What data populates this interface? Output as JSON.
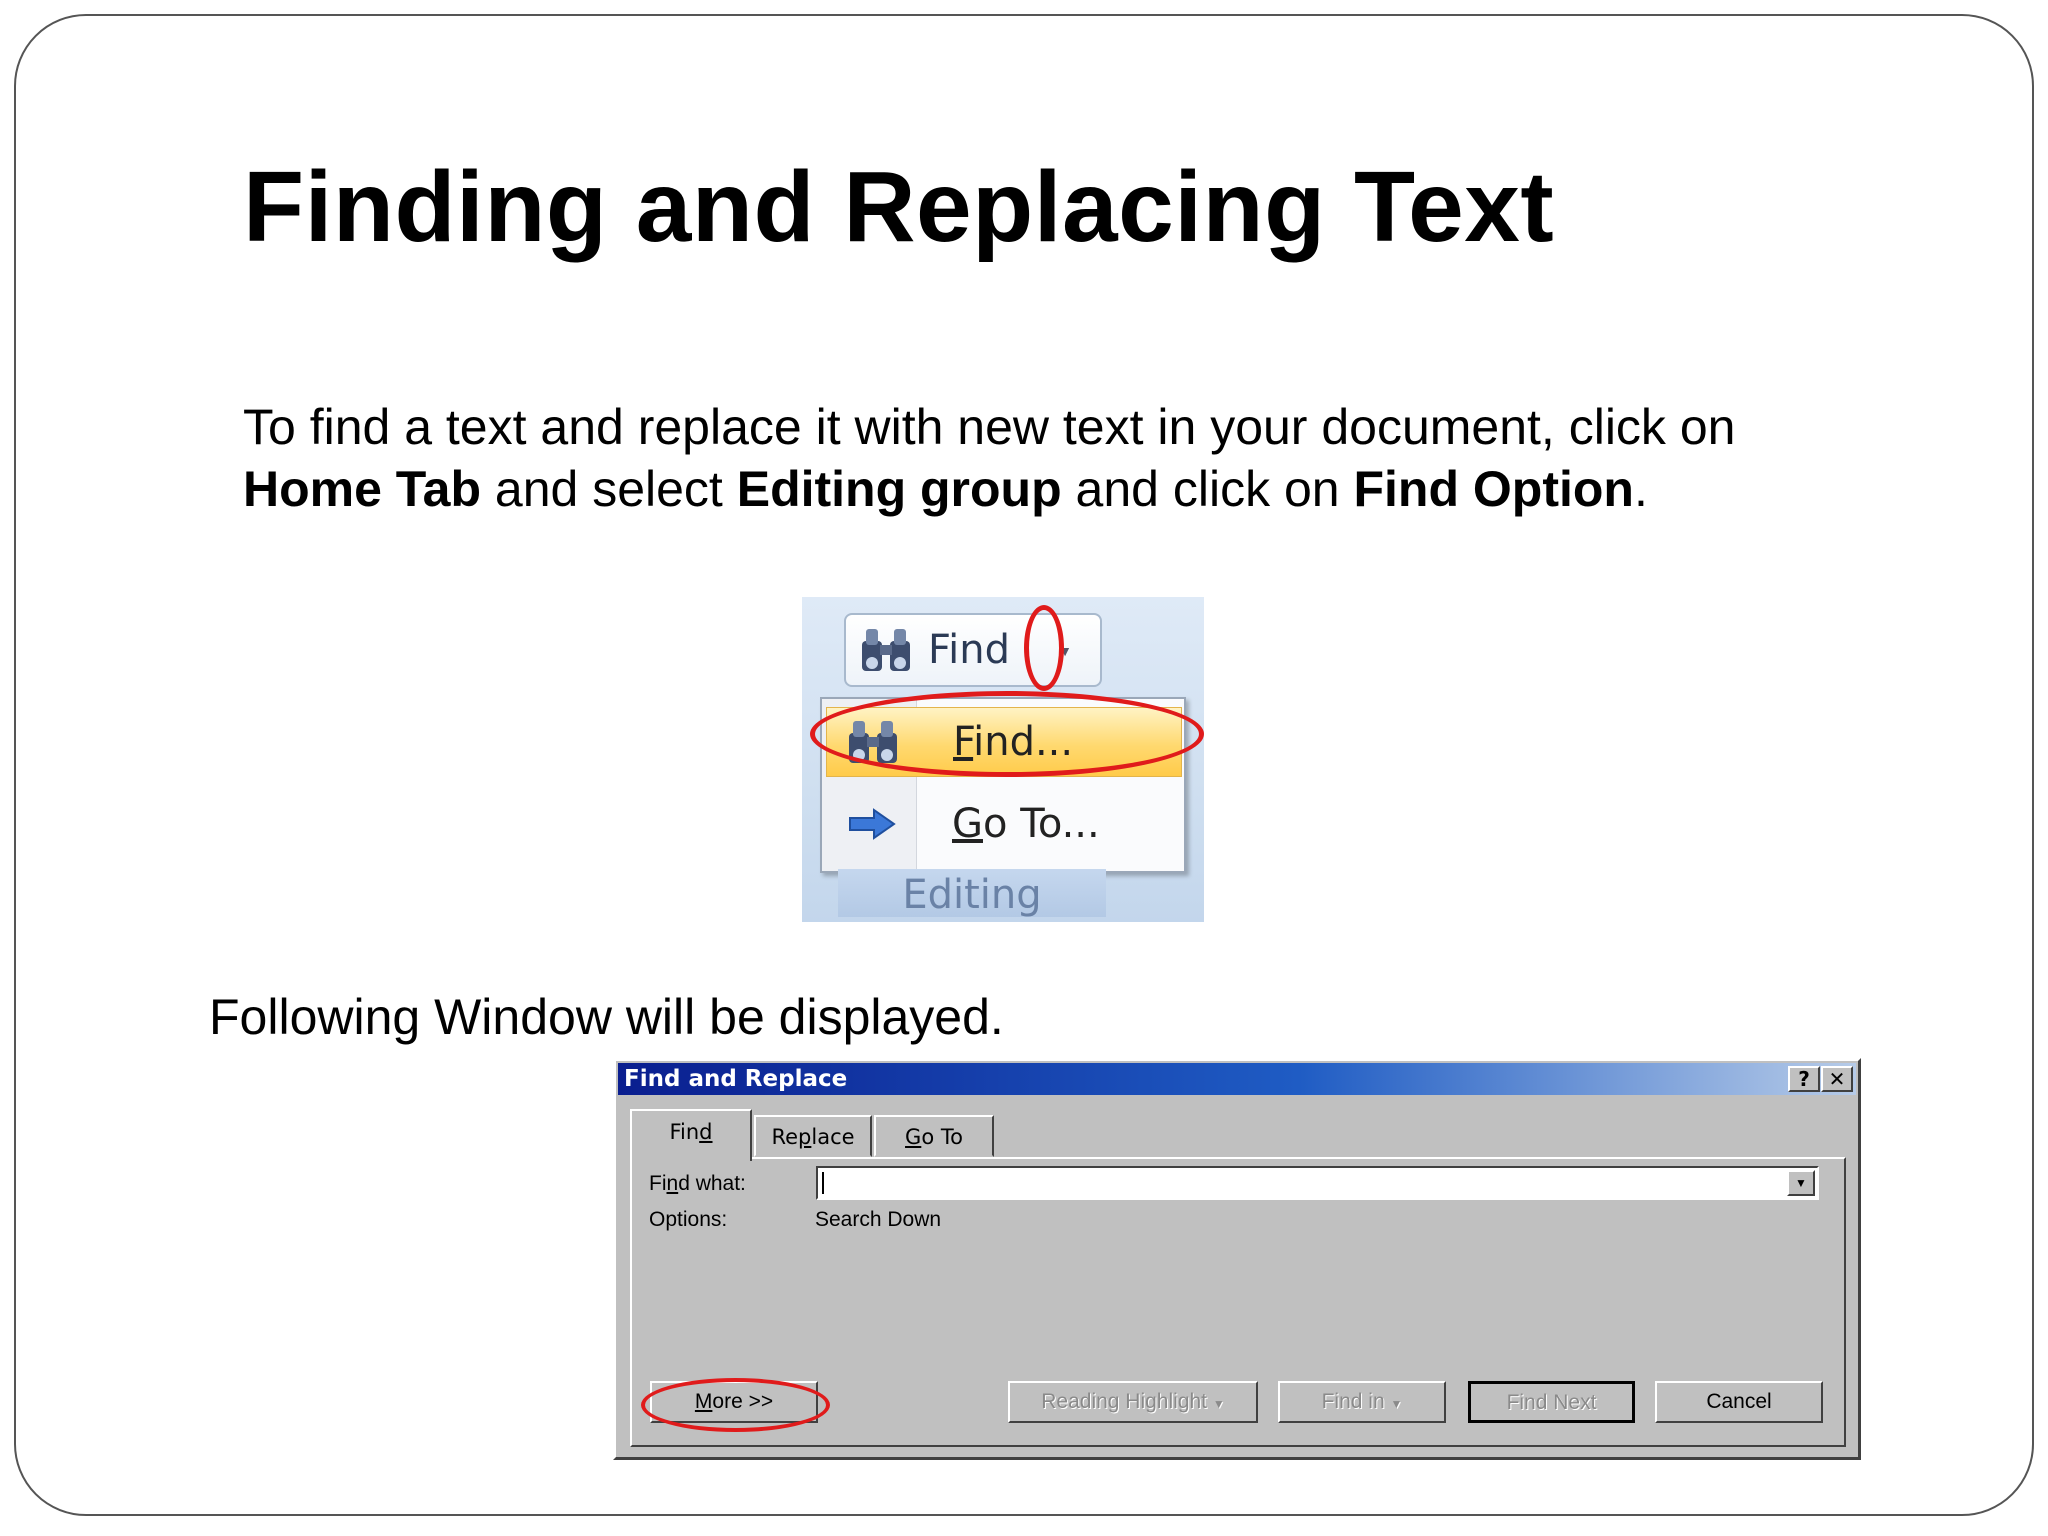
{
  "slide": {
    "title": "Finding and Replacing Text",
    "intro": {
      "text_1": "To find a text and replace it with new text in your document, click on",
      "bold_1": "Home Tab",
      "text_2": " and select ",
      "bold_2": "Editing group",
      "text_3": " and click on ",
      "bold_3": "Find Option",
      "text_4": "."
    },
    "following_text": "Following Window will be displayed."
  },
  "ribbon": {
    "find_button_label": "Find",
    "menu_items": [
      {
        "label_prefix": "F",
        "label_rest": "ind...",
        "icon": "binoculars-icon"
      },
      {
        "label_prefix": "G",
        "label_rest": "o To...",
        "icon": "arrow-right-icon"
      }
    ],
    "group_label": "Editing"
  },
  "dialog": {
    "title": "Find and Replace",
    "help_glyph": "?",
    "close_glyph": "✕",
    "tabs": [
      {
        "pre": "Fin",
        "u": "d",
        "post": ""
      },
      {
        "pre": "Re",
        "u": "p",
        "post": "lace"
      },
      {
        "pre": "",
        "u": "G",
        "post": "o To"
      }
    ],
    "find_what_label_pre": "Fi",
    "find_what_label_u": "n",
    "find_what_label_post": "d what:",
    "find_what_value": "",
    "options_label": "Options:",
    "options_value": "Search Down",
    "buttons": {
      "more_u": "M",
      "more_rest": "ore >>",
      "reading_highlight": "Reading Highlight",
      "find_in": "Find in",
      "find_next": "Find Next",
      "cancel": "Cancel"
    }
  },
  "colors": {
    "annotation_red": "#e01b1b",
    "titlebar_blue": "#0a1e8f",
    "dialog_gray": "#c0c0c0"
  }
}
